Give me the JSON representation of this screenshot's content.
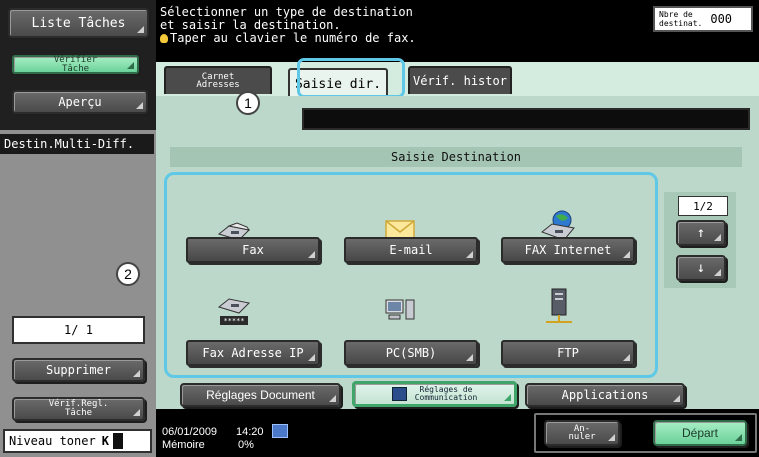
{
  "left_panel": {
    "liste_taches": "Liste Tâches",
    "verifier_tache_line1": "Vérifier",
    "verifier_tache_line2": "Tâche",
    "apercu": "Aperçu",
    "destin_multi_diff": "Destin.Multi-Diff.",
    "page_counter": "1/  1",
    "supprimer": "Supprimer",
    "verif_regl_line1": "Vérif.Regl.",
    "verif_regl_line2": "Tâche",
    "niveau_toner": "Niveau toner",
    "toner_letter": "K"
  },
  "header": {
    "instruction_line1": "Sélectionner un type de destination",
    "instruction_line2": "et saisir la destination.",
    "instruction_line3": "Taper au clavier le numéro de fax.",
    "dest_count_label_line1": "Nbre de",
    "dest_count_label_line2": "destinat.",
    "dest_count_value": "000"
  },
  "tabs": {
    "carnet_line1": "Carnet",
    "carnet_line2": "Adresses",
    "saisie_dir": "Saisie dir.",
    "verif_histor": "Vérif. histor"
  },
  "content": {
    "section_title": "Saisie Destination",
    "destinations": {
      "fax": "Fax",
      "email": "E-mail",
      "fax_internet": "FAX Internet",
      "fax_ip": "Fax Adresse IP",
      "pc_smb": "PC(SMB)",
      "ftp": "FTP"
    },
    "pager": "1/2",
    "pager_up": "↑",
    "pager_down": "↓"
  },
  "functions": {
    "reglages_document": "Réglages Document",
    "reglages_comm_line1": "Réglages de",
    "reglages_comm_line2": "Communication",
    "applications": "Applications"
  },
  "status": {
    "date": "06/01/2009",
    "time": "14:20",
    "memoire_label": "Mémoire",
    "memoire_value": "0%",
    "annuler_line1": "An-",
    "annuler_line2": "nuler",
    "depart": "Départ"
  },
  "callouts": {
    "one": "1",
    "two": "2"
  },
  "colors": {
    "highlight_callout": "#5fc8e6",
    "active_green": "#6cd19a",
    "panel_bg": "#bcd8ca"
  }
}
